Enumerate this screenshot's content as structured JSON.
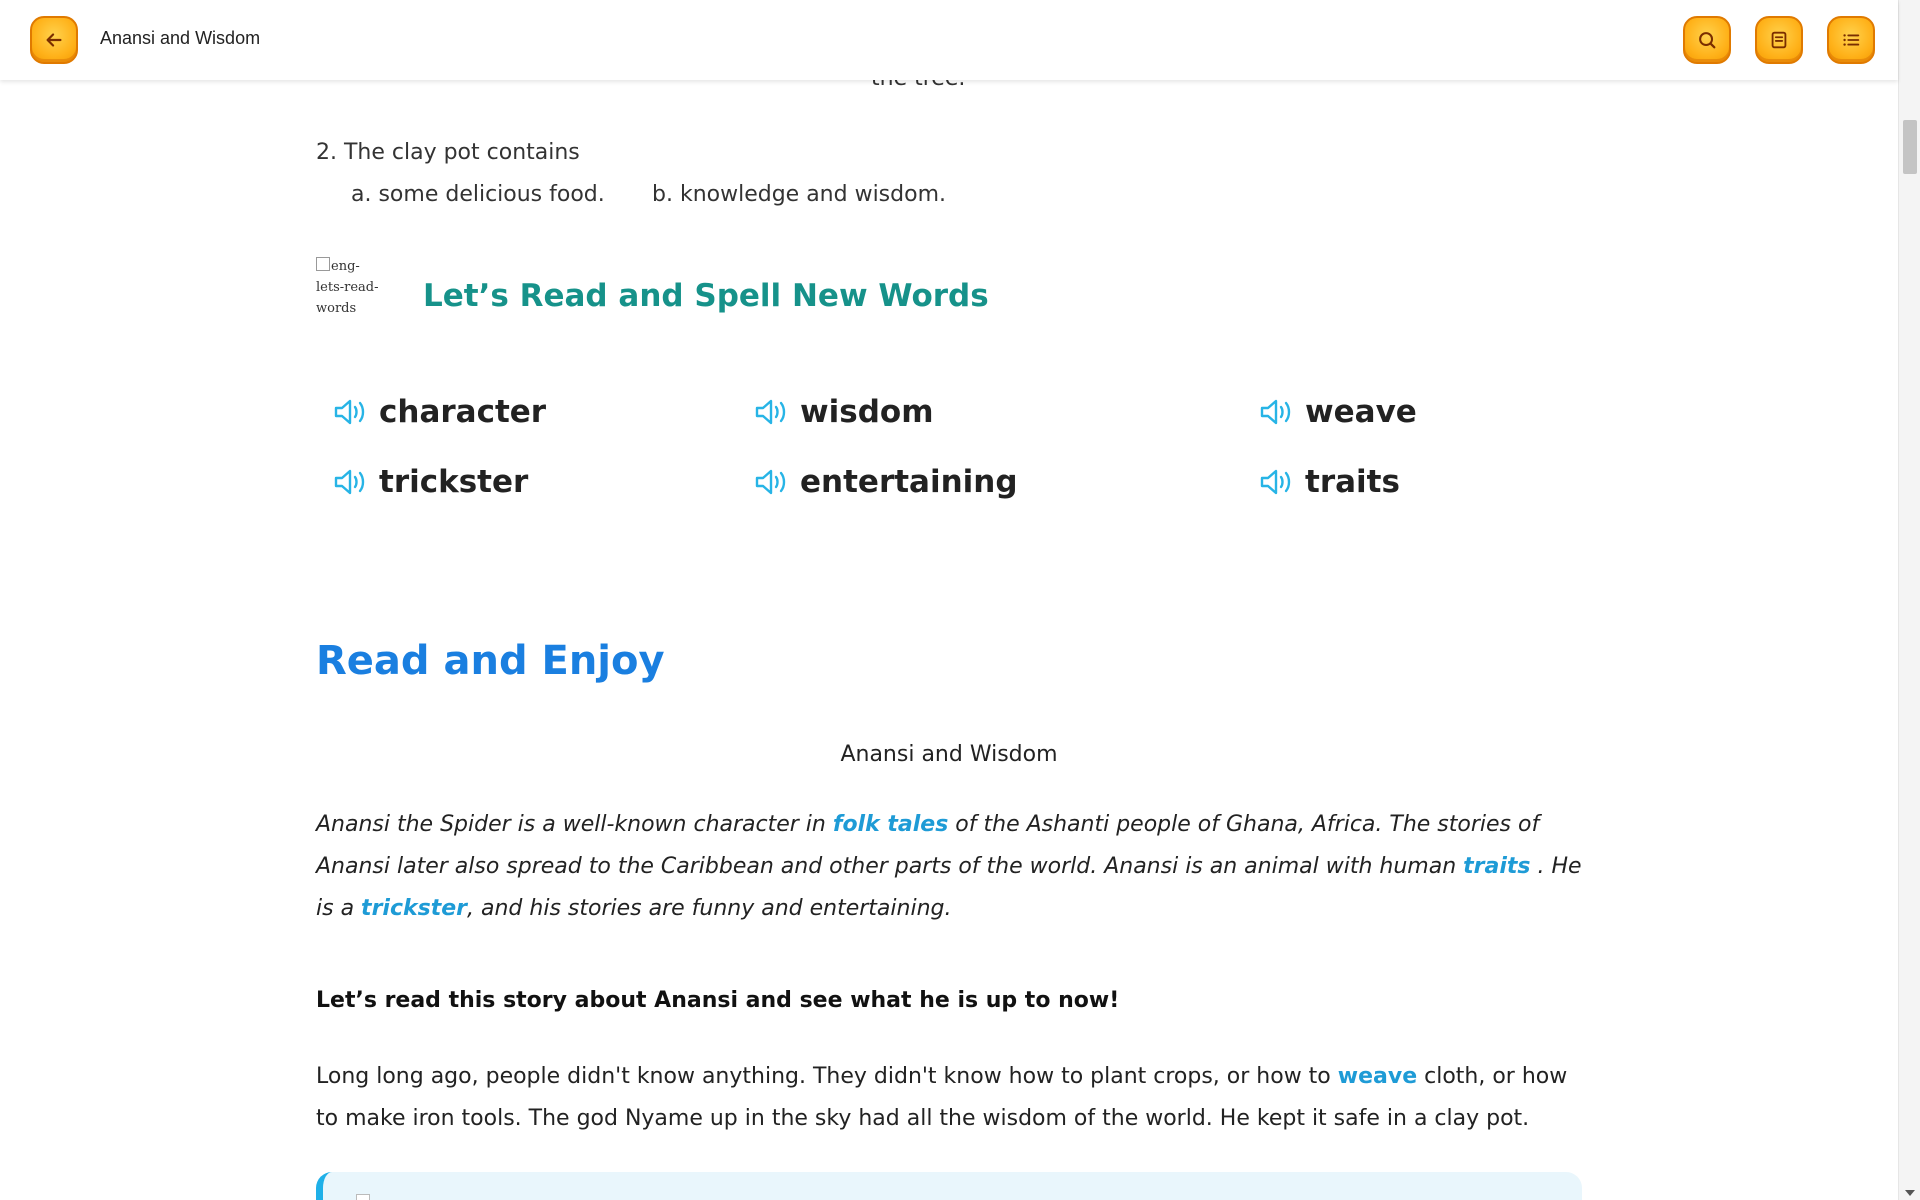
{
  "header": {
    "title": "Anansi and Wisdom",
    "icons": {
      "back": "arrow-left-icon",
      "search": "search-icon",
      "notes": "notes-icon",
      "toc": "list-icon"
    },
    "accent": "#ffb21a"
  },
  "quiz": {
    "partial_text": "the tree.",
    "question": "2. The clay pot contains",
    "option_a": "a. some delicious food.",
    "option_b": "b. knowledge and wisdom."
  },
  "words_section": {
    "image_alt": "eng-lets-read-words",
    "title": "Let’s Read and Spell New Words",
    "words": [
      "character",
      "wisdom",
      "weave",
      "trickster",
      "entertaining",
      "traits"
    ],
    "icon": "speaker-icon"
  },
  "story": {
    "heading": "Read and Enjoy",
    "title": "Anansi and Wisdom",
    "intro": {
      "t1": "Anansi the Spider is a well-known character in ",
      "k1": "folk tales",
      "t2": " of the Ashanti people of Ghana, Africa. The stories of Anansi later also spread to the Caribbean and other parts of the world. Anansi is an animal with human ",
      "k2": "traits",
      "t3": " . He is a ",
      "k3": "trickster",
      "t4": ", and his stories are funny and entertaining."
    },
    "lead": "Let’s read this story about Anansi and see what he is up to now!",
    "para": {
      "t1": "Long long ago, people didn't know anything. They didn't know how to plant crops, or how to ",
      "k1": "weave",
      "t2": " cloth, or how to make iron tools. The god Nyame up in the sky had all the wisdom of the world. He kept it safe in a clay pot."
    }
  },
  "colors": {
    "teal_title": "#16928a",
    "blue_heading": "#1a7fe0",
    "keyword": "#1e9bd6"
  }
}
